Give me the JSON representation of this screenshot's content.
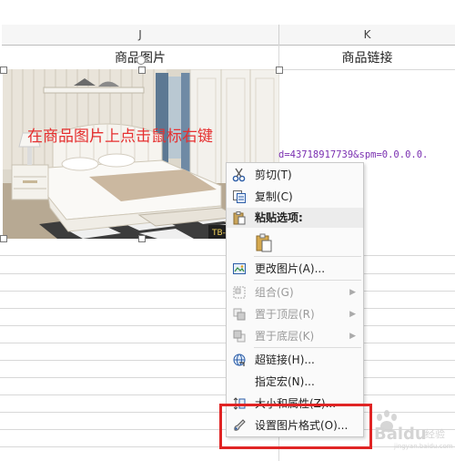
{
  "columns": {
    "j": "J",
    "k": "K"
  },
  "headers": {
    "product_image": "商品图片",
    "product_link": "商品链接"
  },
  "overlay_instruction": "在商品图片上点击鼠标右键",
  "image_badge": "TB-1",
  "link_fragment": "d=43718917739&spm=0.0.0.0.",
  "context_menu": {
    "cut": "剪切(T)",
    "copy": "复制(C)",
    "paste_options": "粘贴选项:",
    "change_picture": "更改图片(A)...",
    "group": "组合(G)",
    "bring_to_front": "置于顶层(R)",
    "send_to_back": "置于底层(K)",
    "hyperlink": "超链接(H)...",
    "assign_macro": "指定宏(N)...",
    "size_properties": "大小和属性(Z)...",
    "format_picture": "设置图片格式(O)..."
  },
  "watermark": {
    "brand": "Baidu",
    "sub": "经验",
    "url": "jingyan.baidu.com"
  },
  "colors": {
    "highlight_box": "#e02424",
    "overlay_text": "#e53030",
    "link_text": "#7a2fb1"
  }
}
